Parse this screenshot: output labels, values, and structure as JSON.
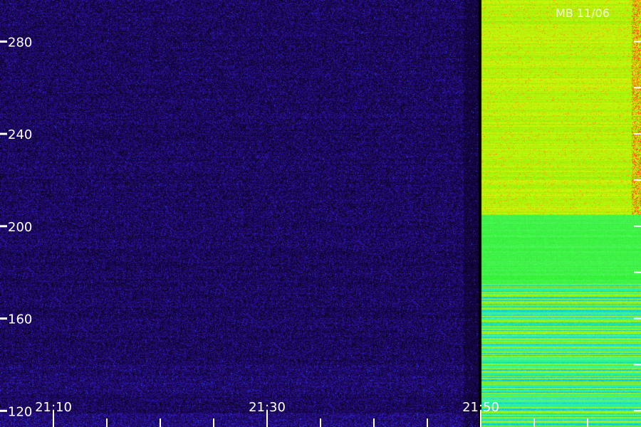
{
  "station_label": "MB 11/06",
  "colors": {
    "background_noise": "#1c0a6e",
    "bright_band_green": "#7dff1a",
    "bright_band_yellow": "#e6ff1a",
    "bright_band_cyan": "#1affb0",
    "hot_red": "#ff3a14",
    "tick": "#ffffff"
  },
  "chart_data": {
    "type": "heatmap",
    "title": "",
    "xlabel": "",
    "ylabel": "",
    "x_ticks": [
      "21:10",
      "21:30",
      "21:50"
    ],
    "x_major_minutes": [
      10,
      30,
      50
    ],
    "x_range_minutes": [
      5,
      65
    ],
    "x_minor_step_minutes": 5,
    "y_ticks": [
      120,
      160,
      200,
      240,
      280
    ],
    "y_range": [
      113,
      298
    ],
    "bright_onset_minutes": 49.8,
    "grid": false,
    "legend": "none"
  }
}
